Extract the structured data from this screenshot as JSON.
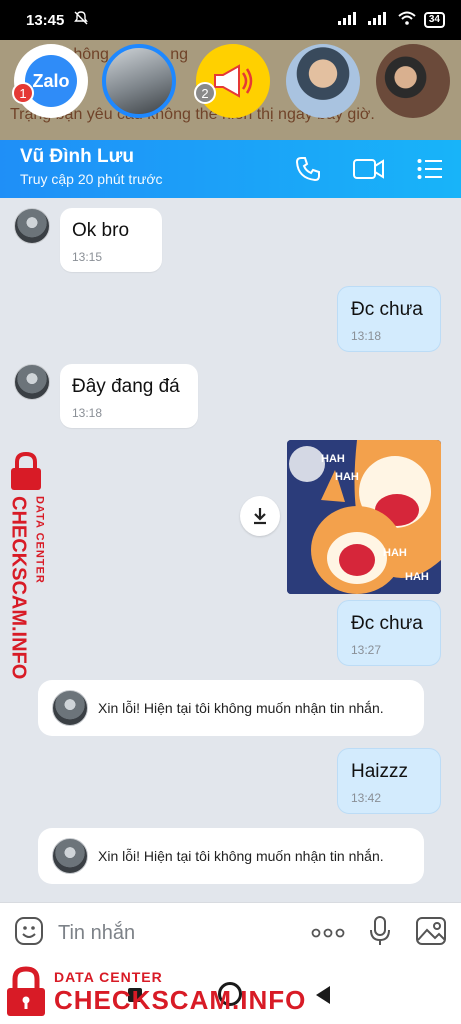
{
  "status_bar": {
    "time": "13:45",
    "battery": "34"
  },
  "bubble_heads": {
    "zalo_label": "Zalo",
    "badge_zalo": "1",
    "badge_megaphone": "2",
    "background_text_line1": "...hông ... ấy ... ng",
    "background_text_line2": "Trạng bạn yêu cầu không thể hiển thị ngày bây giờ."
  },
  "header": {
    "name": "Vũ Đình Lưu",
    "status": "Truy cập 20 phút trước"
  },
  "messages": [
    {
      "text": "Ok bro",
      "time": "13:15"
    },
    {
      "text": "Đc chưa",
      "time": "13:18"
    },
    {
      "text": "Đây đang đá",
      "time": "13:18"
    },
    {
      "text": "Đc chưa",
      "time": "13:27"
    },
    {
      "text": "Xin lỗi! Hiện tại tôi không muốn nhận tin nhắn."
    },
    {
      "text": "Haizzz",
      "time": "13:42"
    },
    {
      "text": "Xin lỗi! Hiện tại tôi không muốn nhận tin nhắn."
    }
  ],
  "sticker_text": [
    "HAH",
    "HAH",
    "HAH",
    "HAH"
  ],
  "input": {
    "placeholder": "Tin nhắn"
  },
  "watermark": {
    "line1": "DATA CENTER",
    "line2": "CHECKSCAM.INFO"
  },
  "icons": [
    "call-icon",
    "video-call-icon",
    "menu-list-icon",
    "download-icon",
    "emoji-icon",
    "more-icon",
    "mic-icon",
    "image-icon"
  ]
}
